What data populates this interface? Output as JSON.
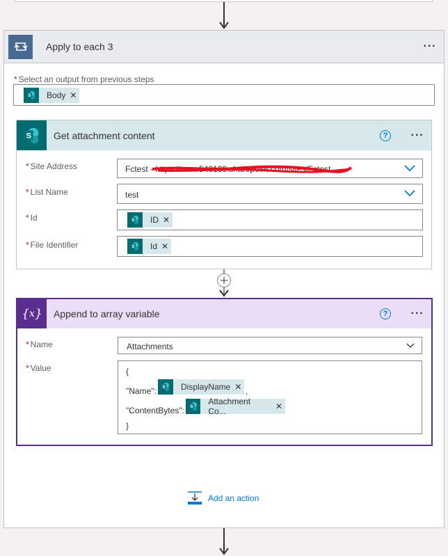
{
  "loop": {
    "title": "Apply to each 3",
    "more": "···",
    "select_label": "Select an output from previous steps",
    "select_token": "Body"
  },
  "get_attachment": {
    "title": "Get attachment content",
    "help": "?",
    "more": "···",
    "fields": {
      "site_address": {
        "label": "Site Address",
        "value": "Fctest - https://........540130.sharepoint.com/sites/Fctest"
      },
      "list_name": {
        "label": "List Name",
        "value": "test"
      },
      "id": {
        "label": "Id",
        "token": "ID"
      },
      "file_identifier": {
        "label": "File Identifier",
        "token": "Id"
      }
    }
  },
  "append": {
    "title": "Append to array variable",
    "help": "?",
    "more": "···",
    "name_label": "Name",
    "name_value": "Attachments",
    "value_label": "Value",
    "value_lines": {
      "open": "{",
      "name_key": "\"Name\":",
      "name_token": "DisplayName",
      "comma": ",",
      "bytes_key": "\"ContentBytes\":",
      "bytes_token": "Attachment Co...",
      "close": "}"
    }
  },
  "add_action": {
    "label": "Add an action"
  },
  "colors": {
    "accent": "#0078d4",
    "loop_icon": "#486991",
    "sharepoint": "#036c70",
    "variable": "#5c2d91",
    "variable_header": "#ebdff8",
    "sp_header": "#d7e8ec",
    "required": "#a4262c"
  },
  "icons": [
    "loop-icon",
    "sharepoint-icon",
    "variable-icon",
    "help-icon",
    "chevron-down-icon",
    "close-icon",
    "plus-icon",
    "add-action-icon"
  ]
}
